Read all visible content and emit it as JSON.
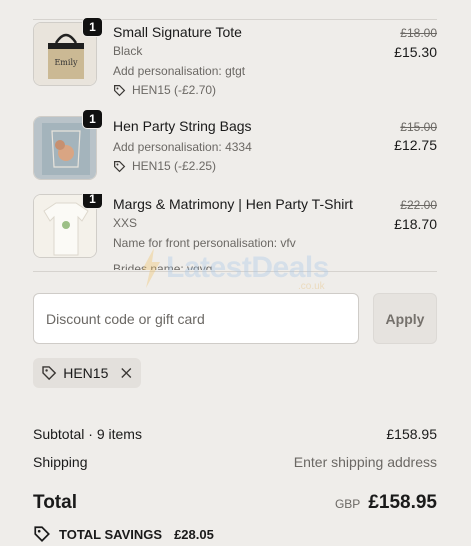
{
  "items": [
    {
      "quantity": "1",
      "title": "Small Signature Tote",
      "details": [
        "Black",
        "Add personalisation: gtgt"
      ],
      "discount": "HEN15 (-£2.70)",
      "original_price": "£18.00",
      "price": "£15.30"
    },
    {
      "quantity": "1",
      "title": "Hen Party String Bags",
      "details": [
        "Add personalisation: 4334"
      ],
      "discount": "HEN15 (-£2.25)",
      "original_price": "£15.00",
      "price": "£12.75"
    },
    {
      "quantity": "1",
      "title": "Margs & Matrimony | Hen Party T-Shirt",
      "details": [
        "XXS",
        "Name for front personalisation: vfv",
        "Brides name: vgvg"
      ],
      "original_price": "£22.00",
      "price": "£18.70"
    }
  ],
  "discount_input": {
    "placeholder": "Discount code or gift card"
  },
  "apply_label": "Apply",
  "applied_code": "HEN15",
  "summary": {
    "subtotal_label": "Subtotal · 9 items",
    "subtotal_value": "£158.95",
    "shipping_label": "Shipping",
    "shipping_value": "Enter shipping address",
    "total_label": "Total",
    "currency": "GBP",
    "total_value": "£158.95",
    "savings_label": "TOTAL SAVINGS",
    "savings_value": "£28.05"
  },
  "watermark": {
    "text": "LatestDeals",
    "sub": ".co.uk"
  },
  "colors": {
    "background": "#efedea",
    "badge": "#111111",
    "muted": "#6b6864"
  }
}
